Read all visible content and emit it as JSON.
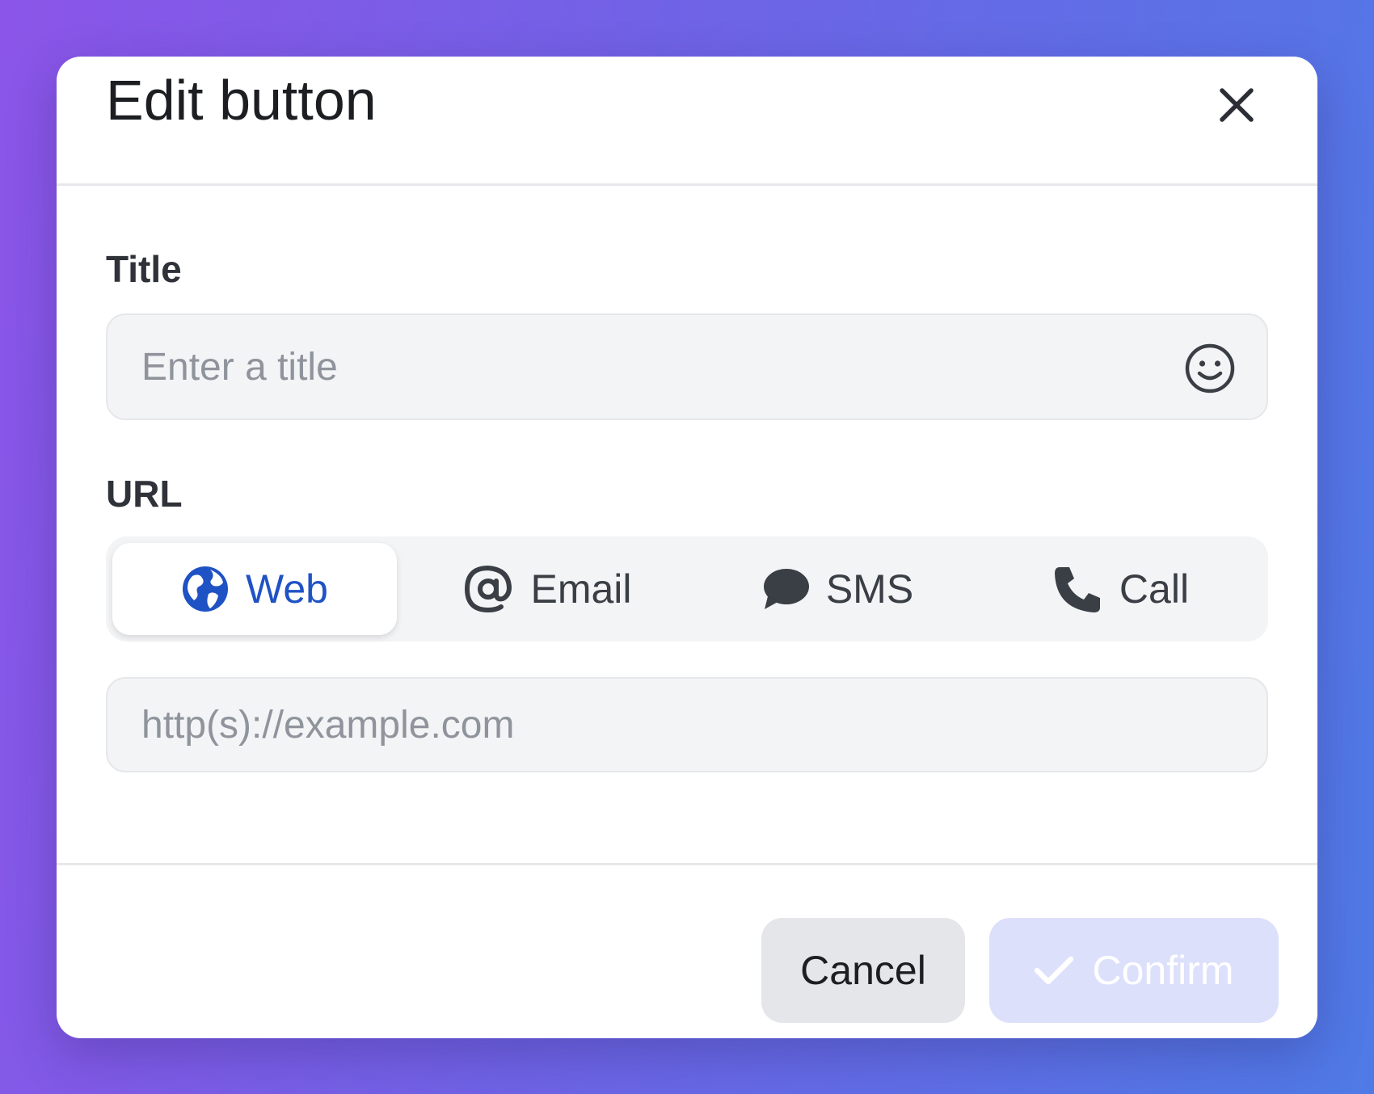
{
  "dialog": {
    "title": "Edit button",
    "close_icon": "close-icon"
  },
  "title_field": {
    "label": "Title",
    "placeholder": "Enter a title",
    "value": "",
    "emoji_icon": "smiley-icon"
  },
  "url_field": {
    "label": "URL",
    "tabs": [
      {
        "label": "Web",
        "icon": "globe-icon",
        "active": true
      },
      {
        "label": "Email",
        "icon": "at-icon",
        "active": false
      },
      {
        "label": "SMS",
        "icon": "chat-bubble-icon",
        "active": false
      },
      {
        "label": "Call",
        "icon": "phone-icon",
        "active": false
      }
    ],
    "placeholder": "http(s)://example.com",
    "value": ""
  },
  "footer": {
    "cancel_label": "Cancel",
    "confirm_label": "Confirm",
    "confirm_icon": "check-icon",
    "confirm_disabled": true
  },
  "colors": {
    "accent": "#1f52c4",
    "confirm_bg_disabled": "#dde0fb",
    "field_bg": "#f3f4f6"
  }
}
